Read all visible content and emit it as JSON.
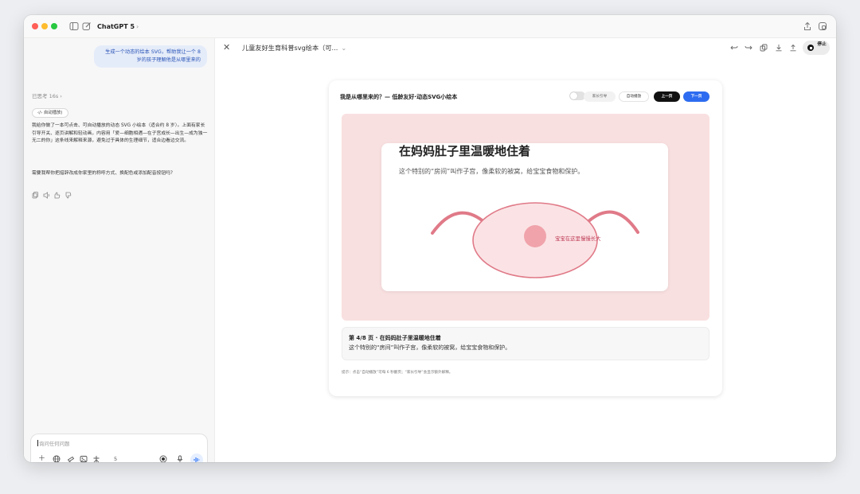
{
  "app": {
    "title": "ChatGPT 5",
    "title_chevron": "›"
  },
  "titlebar_icons": {
    "sidebar": "sidebar-icon",
    "new_chat": "new-chat-icon",
    "share": "share-icon",
    "window": "window-icon"
  },
  "sidebar": {
    "user_message": "生成一个动态的绘本 SVG，帮助我让一个 8 岁的孩子理解他是从哪里来的",
    "thinking_label": "已思考 16s ›",
    "artifact_chip": "‹/› 自动播放)",
    "reply_paragraph_1": "我给你做了一本可点击、可自动播放的动态 SVG 小绘本（适合约 8 岁）。上面有家长引导开关、逐页讲解和轻动画，内容用「爱—细胞相遇—在子宫成长—出生—成为独一无二的你」这条线来解释来源，避免过于具体的生理细节，适合边看边交流。",
    "reply_paragraph_2": "需要我帮你把措辞改成你家里的称呼方式、换配色或添加配音按钮吗？",
    "action_icons": [
      "copy-icon",
      "speaker-icon",
      "thumbs-up-icon",
      "thumbs-down-icon"
    ]
  },
  "composer": {
    "placeholder": "询问任何问题",
    "tools_count": "5"
  },
  "canvas": {
    "title": "儿童友好生育科普svg绘本（可...",
    "title_chevron": "⌄",
    "stop_label": "停止",
    "card": {
      "header": "我是从哪里来的？— 低龄友好·动态SVG小绘本",
      "parent_guide_label": "家长引导",
      "autoplay_label": "自动播放",
      "prev_label": "上一页",
      "next_label": "下一页",
      "scene_title": "在妈妈肚子里温暖地住着",
      "scene_subtitle": "这个特别的“房间”叫作子宫，像柔软的被窝，给宝宝食物和保护。",
      "baby_label": "宝宝在这里慢慢长大",
      "caption_title": "第 4/8 页 · 在妈妈肚子里温暖地住着",
      "caption_text": "这个特别的“房间”叫作子宫，像柔软的被窝，给宝宝食物和保护。",
      "hint": "提示：点击“自动播放”可每 6 秒翻页；“家长引导”会显示额外解释。",
      "parent_guide_on": false
    }
  },
  "colors": {
    "accent_blue": "#2d6cf0",
    "stage_pink": "#f9e0e0",
    "uterus_stroke": "#e07a88",
    "uterus_fill": "#fbe3e5",
    "baby_fill": "#f0a3ab"
  }
}
